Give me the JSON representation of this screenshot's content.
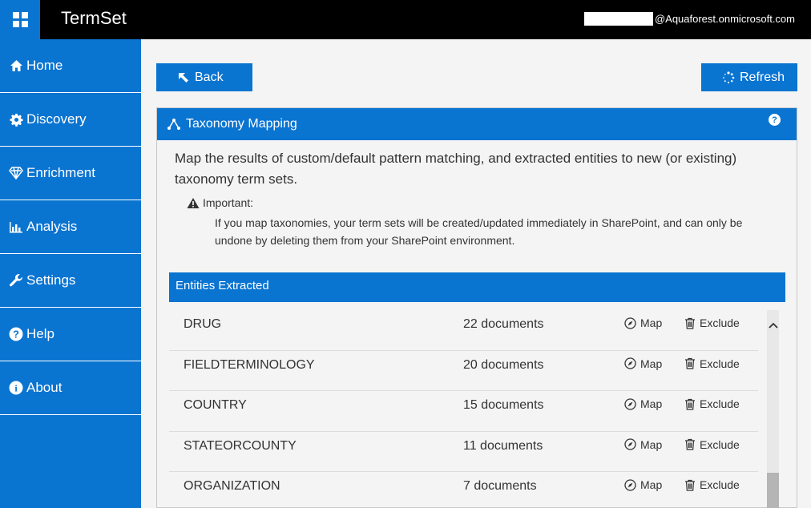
{
  "app": {
    "title": "TermSet"
  },
  "user": {
    "email_suffix": "@Aquaforest.onmicrosoft.com"
  },
  "sidebar": {
    "items": [
      {
        "label": "Home",
        "icon": "home-icon"
      },
      {
        "label": "Discovery",
        "icon": "gear-icon"
      },
      {
        "label": "Enrichment",
        "icon": "diamond-icon"
      },
      {
        "label": "Analysis",
        "icon": "bar-chart-icon"
      },
      {
        "label": "Settings",
        "icon": "wrench-icon"
      },
      {
        "label": "Help",
        "icon": "question-icon"
      },
      {
        "label": "About",
        "icon": "info-icon"
      }
    ]
  },
  "toolbar": {
    "back_label": "Back",
    "refresh_label": "Refresh"
  },
  "panel": {
    "title": "Taxonomy Mapping",
    "help": "?",
    "intro": "Map the results of custom/default pattern matching, and extracted entities to new (or existing) taxonomy term sets.",
    "important_label": "Important:",
    "important_text": "If you map taxonomies, your term sets will be created/updated immediately in SharePoint, and can only be undone by deleting them from your SharePoint environment."
  },
  "entities": {
    "header": "Entities Extracted",
    "map_label": "Map",
    "exclude_label": "Exclude",
    "rows": [
      {
        "name": "DRUG",
        "count": "22 documents"
      },
      {
        "name": "FIELDTERMINOLOGY",
        "count": "20 documents"
      },
      {
        "name": "COUNTRY",
        "count": "15 documents"
      },
      {
        "name": "STATEORCOUNTY",
        "count": "11 documents"
      },
      {
        "name": "ORGANIZATION",
        "count": "7 documents"
      }
    ]
  },
  "colors": {
    "accent": "#0a74d1",
    "topbar": "#000000"
  }
}
